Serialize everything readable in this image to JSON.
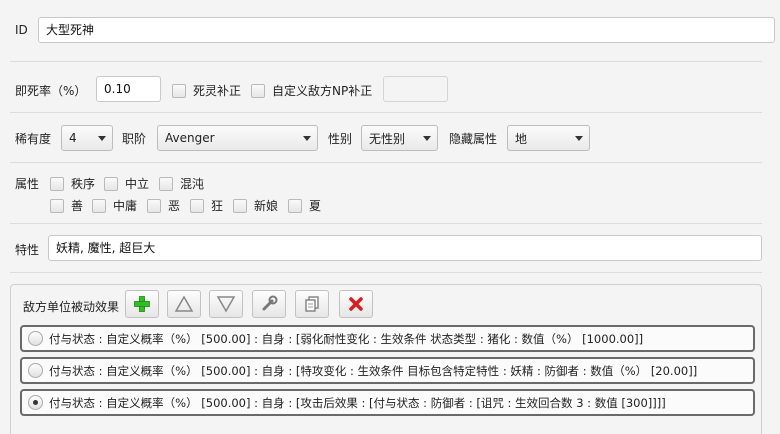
{
  "id": {
    "label": "ID",
    "value": "大型死神"
  },
  "instant_death": {
    "label": "即死率（%）",
    "value": "0.10",
    "undead_label": "死灵补正",
    "custom_np_label": "自定义敌方NP补正",
    "custom_np_value": ""
  },
  "class_row": {
    "rarity_label": "稀有度",
    "rarity_value": "4",
    "class_label": "职阶",
    "class_value": "Avenger",
    "gender_label": "性别",
    "gender_value": "无性别",
    "hidden_attr_label": "隐藏属性",
    "hidden_attr_value": "地"
  },
  "alignment": {
    "label": "属性",
    "row1": [
      "秩序",
      "中立",
      "混沌"
    ],
    "row2": [
      "善",
      "中庸",
      "恶",
      "狂",
      "新娘",
      "夏"
    ]
  },
  "traits": {
    "label": "特性",
    "value": "妖精, 魔性, 超巨大"
  },
  "passive": {
    "title": "敌方单位被动效果",
    "toolbar": [
      "add-icon",
      "move-up-icon",
      "move-down-icon",
      "wrench-icon",
      "copy-icon",
      "delete-icon"
    ],
    "items": [
      {
        "text": "付与状态 : 自定义概率（%） [500.00] : 自身 : [弱化耐性变化 : 生效条件 状态类型 : 猪化 : 数值（%） [1000.00]]",
        "selected": false
      },
      {
        "text": "付与状态 : 自定义概率（%） [500.00] : 自身 : [特攻变化 : 生效条件 目标包含特定特性 : 妖精 : 防御者 : 数值（%） [20.00]]",
        "selected": false
      },
      {
        "text": "付与状态 : 自定义概率（%） [500.00] : 自身 : [攻击后效果 : [付与状态 : 防御者 : [诅咒 : 生效回合数 3 : 数值 [300]]]]",
        "selected": true
      }
    ]
  },
  "colors": {
    "add": "#2fbf22",
    "delete": "#d61e1e"
  }
}
